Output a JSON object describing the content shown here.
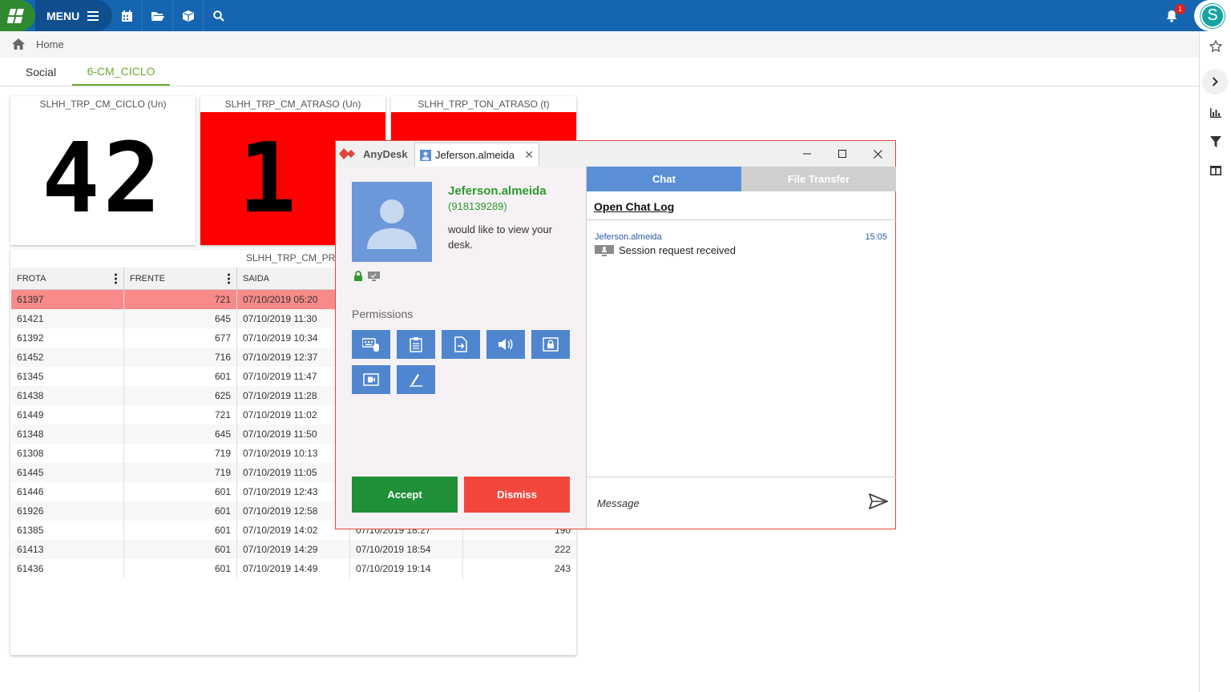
{
  "topbar": {
    "menu_label": "MENU",
    "notification_count": "1",
    "avatar_letter": "S",
    "icons": [
      "calendar-icon",
      "folder-icon",
      "cube-icon",
      "search-icon"
    ]
  },
  "breadcrumb": {
    "home": "Home"
  },
  "tabs": [
    {
      "label": "Social"
    },
    {
      "label": "6-CM_CICLO"
    }
  ],
  "widgets": {
    "ciclo": {
      "title": "SLHH_TRP_CM_CICLO (Un)",
      "value": "42"
    },
    "atraso": {
      "title": "SLHH_TRP_CM_ATRASO (Un)",
      "value": "1",
      "color": "#ff0000"
    },
    "ton_atraso": {
      "title": "SLHH_TRP_TON_ATRASO (t)",
      "color": "#ff0000"
    },
    "prev": {
      "title": "SLHH_TRP_CM_PREV_60MINU"
    }
  },
  "table": {
    "columns": [
      "FROTA",
      "FRENTE",
      "SAIDA"
    ],
    "rows": [
      {
        "frota": "61397",
        "frente": "721",
        "saida": "07/10/2019 05:20",
        "c4": "",
        "c5": ""
      },
      {
        "frota": "61421",
        "frente": "645",
        "saida": "07/10/2019 11:30",
        "c4": "",
        "c5": ""
      },
      {
        "frota": "61392",
        "frente": "677",
        "saida": "07/10/2019 10:34",
        "c4": "",
        "c5": ""
      },
      {
        "frota": "61452",
        "frente": "716",
        "saida": "07/10/2019 12:37",
        "c4": "",
        "c5": ""
      },
      {
        "frota": "61345",
        "frente": "601",
        "saida": "07/10/2019 11:47",
        "c4": "",
        "c5": ""
      },
      {
        "frota": "61438",
        "frente": "625",
        "saida": "07/10/2019 11:28",
        "c4": "",
        "c5": ""
      },
      {
        "frota": "61449",
        "frente": "721",
        "saida": "07/10/2019 11:02",
        "c4": "",
        "c5": ""
      },
      {
        "frota": "61348",
        "frente": "645",
        "saida": "07/10/2019 11:50",
        "c4": "",
        "c5": ""
      },
      {
        "frota": "61308",
        "frente": "719",
        "saida": "07/10/2019 10:13",
        "c4": "",
        "c5": ""
      },
      {
        "frota": "61445",
        "frente": "719",
        "saida": "07/10/2019 11:05",
        "c4": "",
        "c5": ""
      },
      {
        "frota": "61446",
        "frente": "601",
        "saida": "07/10/2019 12:43",
        "c4": "",
        "c5": ""
      },
      {
        "frota": "61926",
        "frente": "601",
        "saida": "07/10/2019 12:58",
        "c4": "",
        "c5": ""
      },
      {
        "frota": "61385",
        "frente": "601",
        "saida": "07/10/2019 14:02",
        "c4": "07/10/2019 18:27",
        "c5": "190"
      },
      {
        "frota": "61413",
        "frente": "601",
        "saida": "07/10/2019 14:29",
        "c4": "07/10/2019 18:54",
        "c5": "222"
      },
      {
        "frota": "61436",
        "frente": "601",
        "saida": "07/10/2019 14:49",
        "c4": "07/10/2019 19:14",
        "c5": "243"
      }
    ],
    "highlight_color": "#f88a8a"
  },
  "anydesk": {
    "brand": "AnyDesk",
    "tab_label": "Jeferson.almeida",
    "user_name": "Jeferson.almeida",
    "user_id": "(918139289)",
    "request_text": "would like to view your desk.",
    "permissions_label": "Permissions",
    "accept_label": "Accept",
    "dismiss_label": "Dismiss",
    "chat_tab": "Chat",
    "file_transfer_tab": "File Transfer",
    "open_chat_log": "Open Chat Log",
    "chat_sender": "Jeferson.almeida",
    "chat_time": "15:05",
    "chat_message": "Session request received",
    "message_placeholder": "Message",
    "permission_icons": [
      "keyboard-mouse-icon",
      "clipboard-icon",
      "file-transfer-icon",
      "sound-icon",
      "lock-screen-icon",
      "video-icon",
      "draw-icon"
    ]
  }
}
